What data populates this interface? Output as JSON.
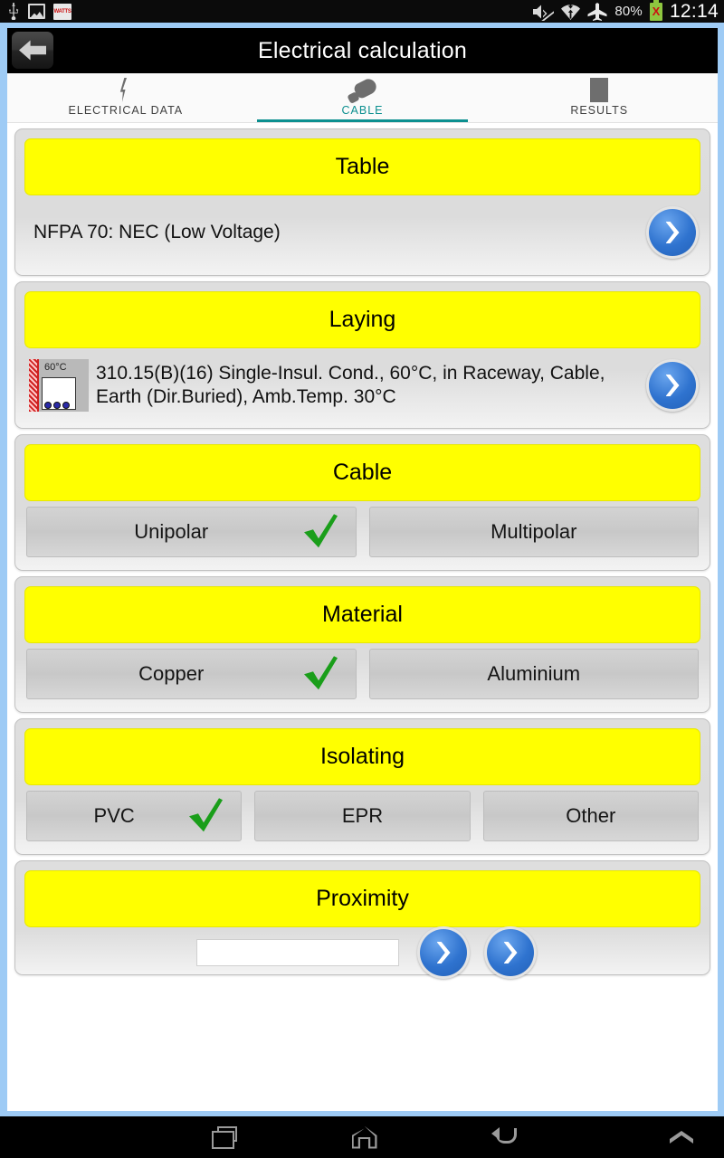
{
  "statusbar": {
    "icons_left": [
      "usb-icon",
      "photo-icon",
      "app-icon"
    ],
    "app_icon_text": "WATTS",
    "icons_right": [
      "mute-icon",
      "wifi-icon",
      "airplane-icon"
    ],
    "battery_percent": "80%",
    "battery_icon": "battery-warning-icon",
    "battery_glyph": "X",
    "clock": "12:14"
  },
  "titlebar": {
    "back_icon": "back-arrow-icon",
    "title": "Electrical calculation"
  },
  "tabs": [
    {
      "label": "ELECTRICAL DATA",
      "icon": "lightning-bolt-icon",
      "active": false
    },
    {
      "label": "CABLE",
      "icon": "cable-plug-icon",
      "active": true
    },
    {
      "label": "RESULTS",
      "icon": "rectangle-icon",
      "active": false
    }
  ],
  "accent_color": "#0b8f8f",
  "header_color": "#ffff00",
  "frame_color": "#9ecbf5",
  "check_color": "#1a9e1a",
  "sections": {
    "table": {
      "title": "Table",
      "value": "NFPA 70: NEC (Low Voltage)",
      "next_icon": "chevron-right-icon"
    },
    "laying": {
      "title": "Laying",
      "thumb_temp": "60°C",
      "value": "310.15(B)(16) Single-Insul. Cond., 60°C, in Raceway, Cable, Earth (Dir.Buried), Amb.Temp. 30°C",
      "next_icon": "chevron-right-icon"
    },
    "cable": {
      "title": "Cable",
      "options": [
        {
          "label": "Unipolar",
          "selected": true
        },
        {
          "label": "Multipolar",
          "selected": false
        }
      ]
    },
    "material": {
      "title": "Material",
      "options": [
        {
          "label": "Copper",
          "selected": true
        },
        {
          "label": "Aluminium",
          "selected": false
        }
      ]
    },
    "isolating": {
      "title": "Isolating",
      "options": [
        {
          "label": "PVC",
          "selected": true
        },
        {
          "label": "EPR",
          "selected": false
        },
        {
          "label": "Other",
          "selected": false
        }
      ]
    },
    "proximity": {
      "title": "Proximity",
      "field_value": "",
      "buttons": [
        "chevron-button-1",
        "chevron-button-2"
      ]
    }
  },
  "navbar": {
    "recents": "recents-icon",
    "home": "home-icon",
    "back": "back-icon",
    "expand": "chevron-up-icon"
  }
}
